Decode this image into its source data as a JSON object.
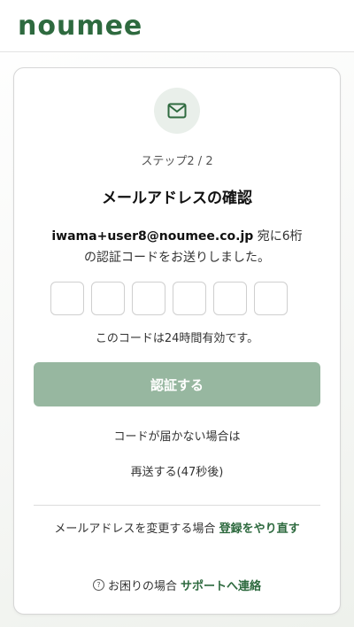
{
  "header": {
    "logo": "noumee"
  },
  "card": {
    "icon": "mail-icon",
    "step": "ステップ2 / 2",
    "title": "メールアドレスの確認",
    "email": "iwama+user8@noumee.co.jp",
    "desc_after_email": " 宛に6桁",
    "desc_line2": "の認証コードをお送りしました。",
    "code_boxes": [
      "",
      "",
      "",
      "",
      "",
      ""
    ],
    "validity": "このコードは24時間有効です。",
    "verify_button": "認証する",
    "no_code": "コードが届かない場合は",
    "resend": "再送する(47秒後)",
    "change_email_text": "メールアドレスを変更する場合 ",
    "change_email_link": "登録をやり直す",
    "help_text": "お困りの場合 ",
    "help_link": "サポートへ連絡"
  },
  "colors": {
    "brand": "#2e6a3f",
    "button_disabled": "#97b7a0",
    "icon_bg": "#e9efea"
  }
}
